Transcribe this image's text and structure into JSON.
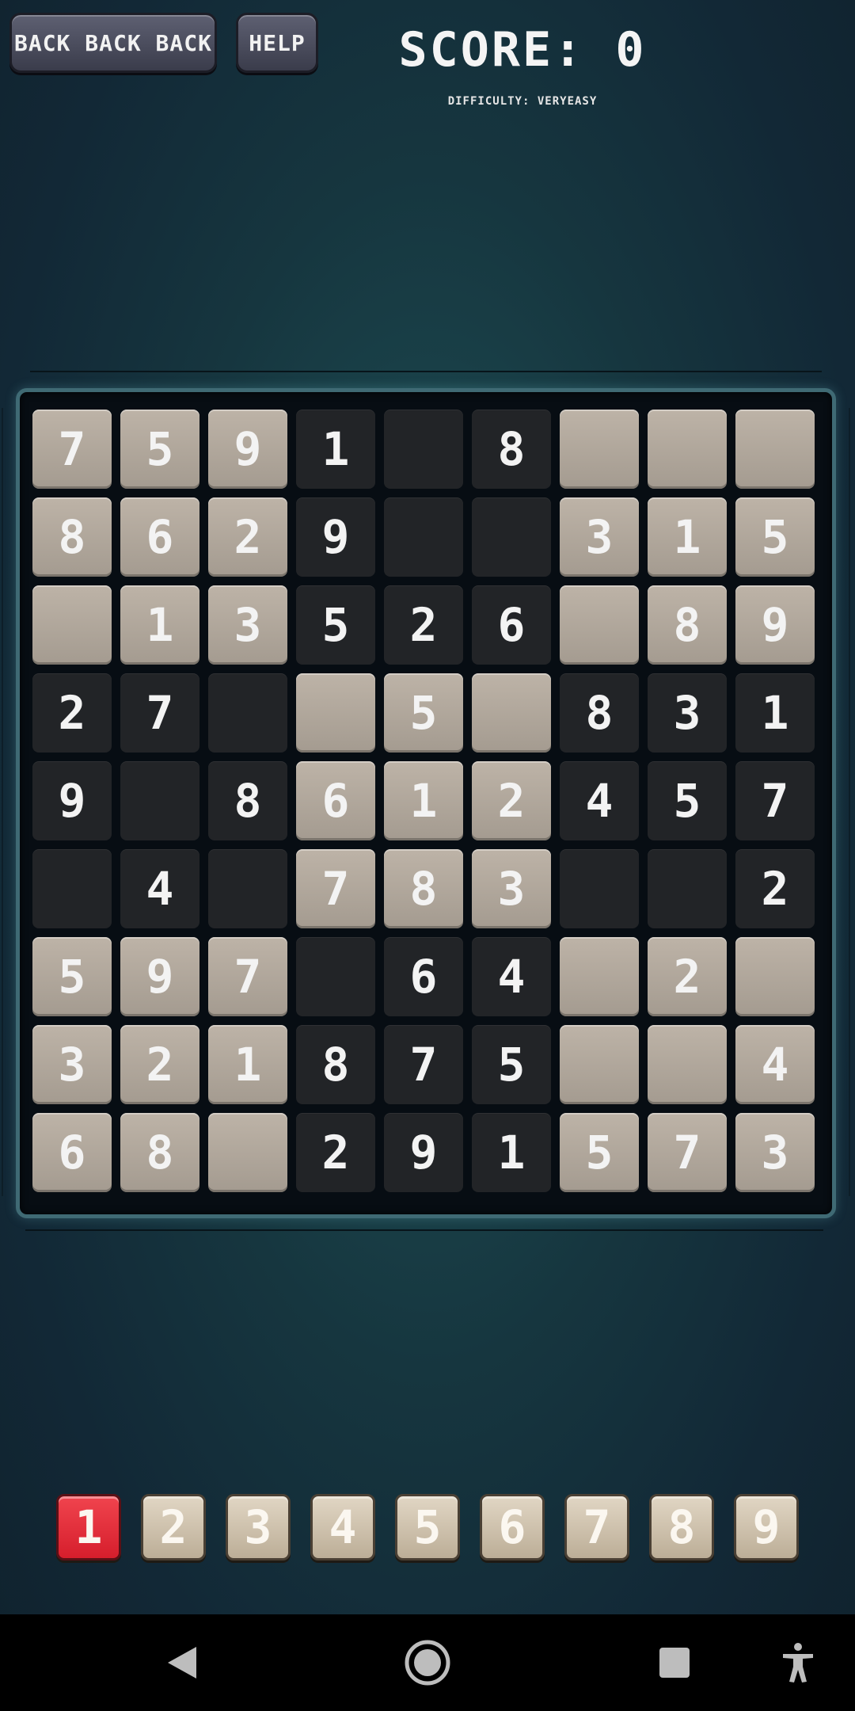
{
  "header": {
    "back_label": "BACK BACK BACK",
    "help_label": "HELP",
    "score_text": "SCORE: 0",
    "difficulty_text": "DIFFICULTY: VERYEASY"
  },
  "board": {
    "rows": [
      [
        "7",
        "5",
        "9",
        "1",
        "",
        "8",
        "",
        "",
        ""
      ],
      [
        "8",
        "6",
        "2",
        "9",
        "",
        "",
        "3",
        "1",
        "5"
      ],
      [
        "",
        "1",
        "3",
        "5",
        "2",
        "6",
        "",
        "8",
        "9"
      ],
      [
        "2",
        "7",
        "",
        "",
        "5",
        "",
        "8",
        "3",
        "1"
      ],
      [
        "9",
        "",
        "8",
        "6",
        "1",
        "2",
        "4",
        "5",
        "7"
      ],
      [
        "",
        "4",
        "",
        "7",
        "8",
        "3",
        "",
        "",
        "2"
      ],
      [
        "5",
        "9",
        "7",
        "",
        "6",
        "4",
        "",
        "2",
        ""
      ],
      [
        "3",
        "2",
        "1",
        "8",
        "7",
        "5",
        "",
        "",
        "4"
      ],
      [
        "6",
        "8",
        "",
        "2",
        "9",
        "1",
        "5",
        "7",
        "3"
      ]
    ]
  },
  "picker": {
    "numbers": [
      "1",
      "2",
      "3",
      "4",
      "5",
      "6",
      "7",
      "8",
      "9"
    ],
    "selected": "1"
  },
  "colors": {
    "light_tile": "#b3aa9e",
    "dark_tile": "#222427",
    "selected_picker": "#e52a38",
    "picker_tile": "#d6cab6"
  },
  "navbar": {
    "icons": [
      "back-icon",
      "home-icon",
      "recents-icon",
      "accessibility-icon"
    ]
  }
}
